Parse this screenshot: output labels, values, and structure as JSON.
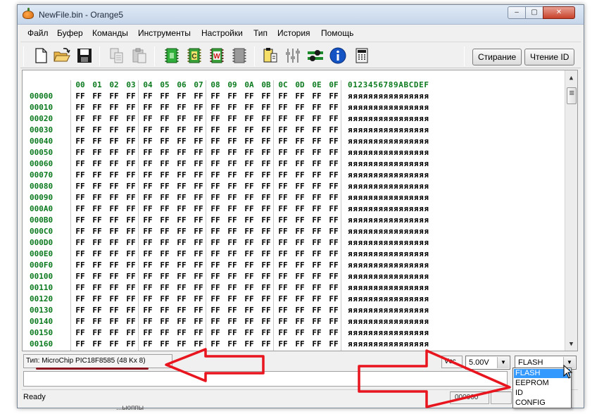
{
  "window": {
    "title": "NewFile.bin - Orange5",
    "controls": {
      "minimize": "‒",
      "maximize": "▢",
      "close": "✕"
    }
  },
  "menu": [
    "Файл",
    "Буфер",
    "Команды",
    "Инструменты",
    "Настройки",
    "Тип",
    "История",
    "Помощь"
  ],
  "toolbar": {
    "icons": [
      "new-file-icon",
      "open-folder-icon",
      "save-icon",
      "copy-icon",
      "paste-icon",
      "chip-read-icon",
      "chip-check-icon",
      "chip-write-icon",
      "chip-erase-icon",
      "clipboard-icon",
      "sliders-icon",
      "settings-icon",
      "info-icon",
      "calculator-icon"
    ],
    "chip_labels": {
      "check": "C",
      "write": "W"
    },
    "erase_label": "Стирание",
    "read_id_label": "Чтение ID"
  },
  "hex": {
    "columns": [
      "00",
      "01",
      "02",
      "03",
      "04",
      "05",
      "06",
      "07",
      "08",
      "09",
      "0A",
      "0B",
      "0C",
      "0D",
      "0E",
      "0F"
    ],
    "ascii_header": "0123456789ABCDEF",
    "addresses": [
      "00000",
      "00010",
      "00020",
      "00030",
      "00040",
      "00050",
      "00060",
      "00070",
      "00080",
      "00090",
      "000A0",
      "000B0",
      "000C0",
      "000D0",
      "000E0",
      "000F0",
      "00100",
      "00110",
      "00120",
      "00130",
      "00140",
      "00150",
      "00160"
    ],
    "cell_value": "FF",
    "ascii_value": "яяяяяяяяяяяяяяяя"
  },
  "type_bar": {
    "type_prefix": "Тип: ",
    "type_value": "MicroChip PIC18F8585 (48 Kx 8)",
    "vcc_label": "Vcc",
    "voltage": "5.00V",
    "memory": "FLASH"
  },
  "dropdown": {
    "options": [
      "FLASH",
      "EEPROM",
      "ID",
      "CONFIG"
    ],
    "selected": "FLASH"
  },
  "status": {
    "text": "Ready",
    "address": "000000"
  },
  "background_fragment": "...ыоппы",
  "colors": {
    "address_green": "#0b7a1e",
    "annotation_red": "#e8141e",
    "selection_blue": "#3399ff"
  }
}
